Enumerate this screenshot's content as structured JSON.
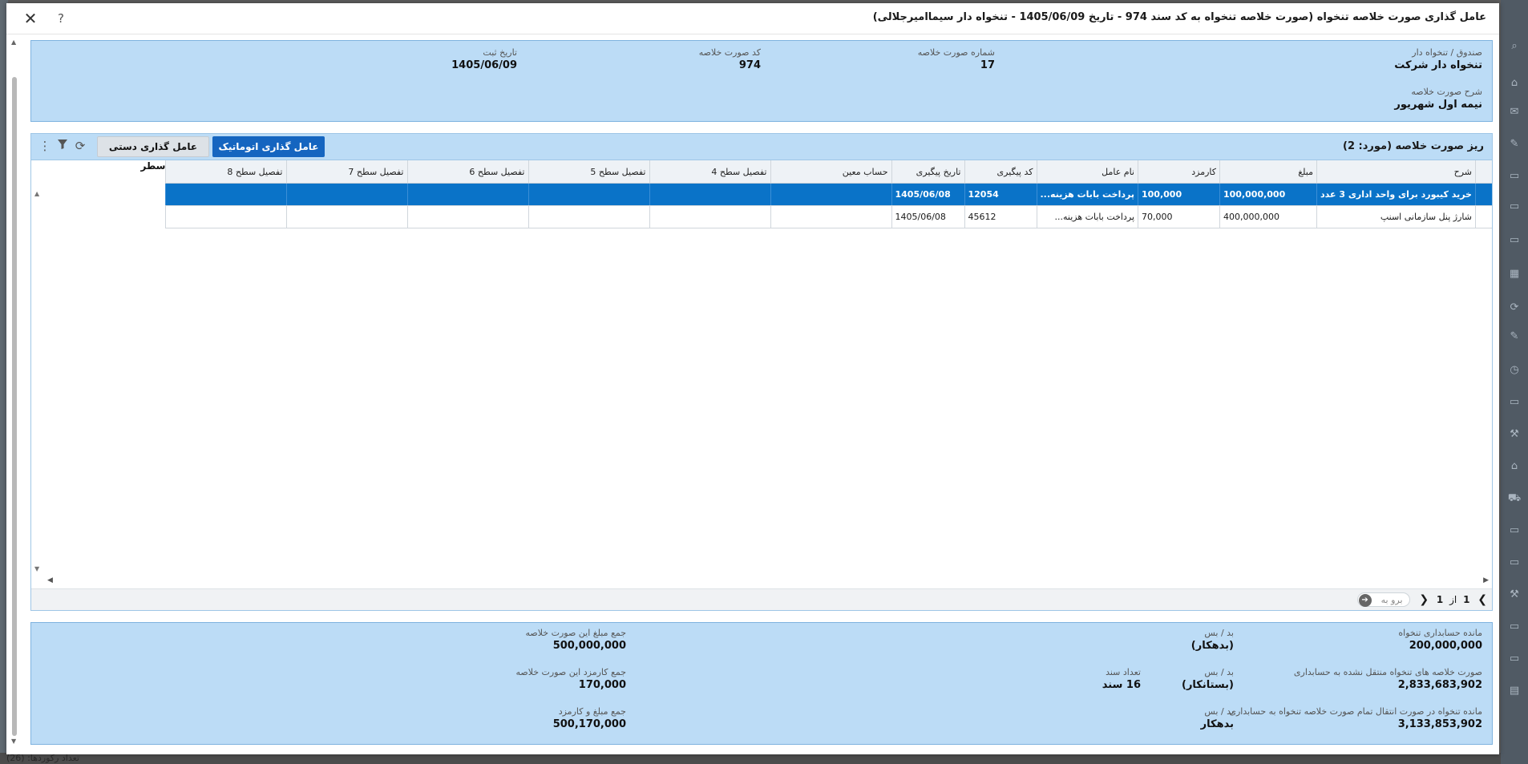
{
  "dialog": {
    "title": "عامل گذاری صورت خلاصه تنخواه (صورت خلاصه تنخواه به کد سند 974 - تاریخ 1405/06/09 - تنخواه دار سیماامیرجلالی)",
    "close_glyph": "✕",
    "help_glyph": "?"
  },
  "summary": {
    "fund_label": "صندوق / تنخواه دار",
    "fund_value": "تنخواه دار شرکت",
    "number_label": "شماره صورت خلاصه",
    "number_value": "17",
    "code_label": "کد صورت خلاصه",
    "code_value": "974",
    "date_label": "تاریخ ثبت",
    "date_value": "1405/06/09",
    "desc_label": "شرح صورت خلاصه",
    "desc_value": "نیمه اول شهریور"
  },
  "grid": {
    "title": "ریز صورت خلاصه (مورد: 2)",
    "auto_button": "عامل گذاری اتوماتیک",
    "manual_button": "عامل گذاری دستی سطر",
    "columns": [
      "شرح",
      "مبلغ",
      "کارمزد",
      "نام عامل",
      "کد پیگیری",
      "تاریخ پیگیری",
      "حساب معین",
      "تفصیل سطح 4",
      "تفصیل سطح 5",
      "تفصیل سطح 6",
      "تفصیل سطح 7",
      "تفصیل سطح 8"
    ],
    "rows": [
      [
        "خرید کیبورد برای واحد اداری 3 عدد",
        "100,000,000",
        "100,000",
        "پرداخت بابات هزینه...",
        "12054",
        "1405/06/08",
        "",
        "",
        "",
        "",
        "",
        ""
      ],
      [
        "شارژ پنل سازمانی اسنپ",
        "400,000,000",
        "70,000",
        "پرداخت بابات هزینه...",
        "45612",
        "1405/06/08",
        "",
        "",
        "",
        "",
        "",
        ""
      ]
    ],
    "selected_row": 0,
    "pager": {
      "current": "1",
      "of_label": "از",
      "total": "1",
      "goto_placeholder": "برو به"
    }
  },
  "totals": {
    "acc_balance_label": "مانده حسابداری تنخواه",
    "acc_balance_value": "200,000,000",
    "acc_balance_dc_label": "بد / بس",
    "acc_balance_dc_value": "(بدهکار)",
    "untransferred_label": "صورت خلاصه های تنخواه منتقل نشده به حسابداری",
    "untransferred_value": "2,833,683,902",
    "untransferred_dc_label": "بد / بس",
    "untransferred_dc_value": "(بستانکار)",
    "doc_count_label": "تعداد سند",
    "doc_count_value": "16 سند",
    "final_balance_label": "مانده تنخواه در صورت انتقال تمام صورت خلاصه تنخواه به حسابداری",
    "final_balance_value": "3,133,853,902",
    "final_dc_label": "بد / بس",
    "final_dc_value": "بدهکار",
    "sum_amount_label": "جمع مبلغ این صورت خلاصه",
    "sum_amount_value": "500,000,000",
    "sum_fee_label": "جمع کارمزد این صورت خلاصه",
    "sum_fee_value": "170,000",
    "sum_total_label": "جمع مبلغ و کارمزد",
    "sum_total_value": "500,170,000"
  },
  "background": {
    "status_text": "تعداد رکوردها: (26)"
  }
}
